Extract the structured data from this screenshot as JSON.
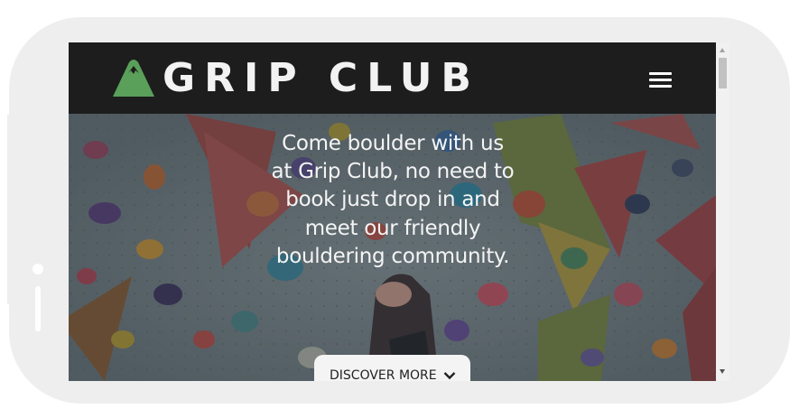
{
  "brand": {
    "name": "GRIP CLUB",
    "logo_icon": "mountain-icon",
    "logo_color": "#5aa05a"
  },
  "navbar": {
    "menu_icon": "hamburger-menu-icon",
    "background": "#1d1d1d"
  },
  "hero": {
    "text": "Come boulder with us at Grip Club, no need to book just drop in and meet our friendly bouldering community.",
    "button_label": "DISCOVER MORE",
    "button_icon": "chevron-down-icon"
  },
  "colors": {
    "frame": "#eeeeee",
    "hero_text": "#f4f4f4"
  }
}
